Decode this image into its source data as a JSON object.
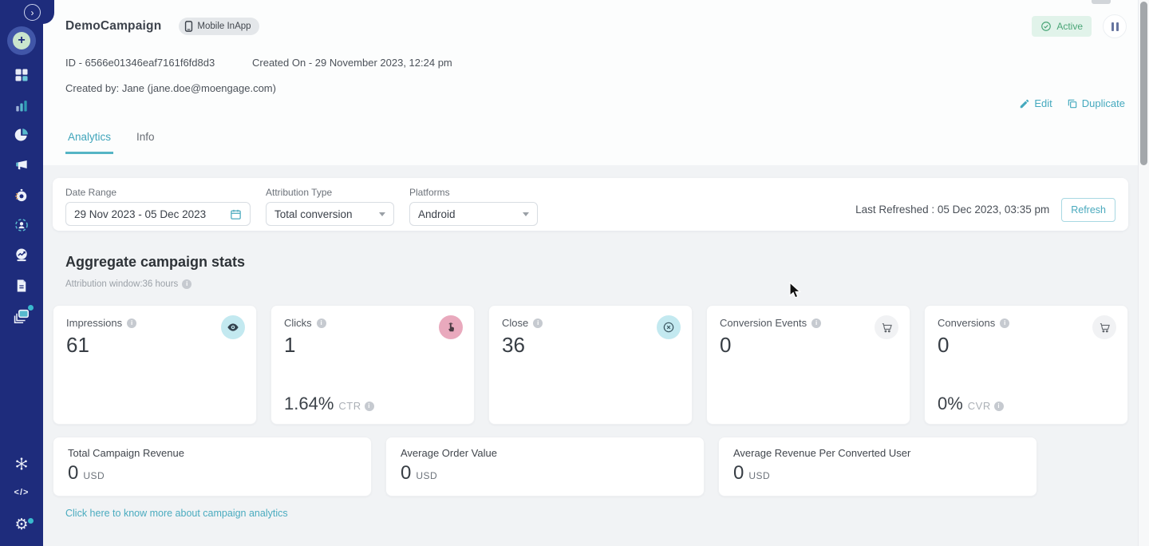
{
  "colors": {
    "navy": "#1e2c7c",
    "teal": "#44a9be",
    "green": "#4aa577",
    "pink_icon_bg": "#e9a9bd",
    "cyan_icon_bg": "#c3e9f0",
    "gray_icon_bg": "#f1f2f4"
  },
  "sidebar": {
    "expand_icon": "chevron-right-icon",
    "items": [
      "plus-create-icon",
      "grid-dashboard-icon",
      "bar-chart-icon",
      "pie-chart-icon",
      "megaphone-icon",
      "stopwatch-icon",
      "user-target-icon",
      "trend-ball-icon",
      "document-icon",
      "layers-icon",
      "asterisk-nodes-icon",
      "code-icon",
      "gear-icon"
    ]
  },
  "header": {
    "title": "DemoCampaign",
    "channel_badge": "Mobile InApp",
    "status_label": "Active",
    "campaign_id": "ID - 6566e01346eaf7161f6fd8d3",
    "created_on": "Created On - 29 November 2023, 12:24 pm",
    "created_by": "Created by: Jane (jane.doe@moengage.com)",
    "edit_label": "Edit",
    "duplicate_label": "Duplicate"
  },
  "tabs": {
    "analytics": "Analytics",
    "info": "Info"
  },
  "filter_bar": {
    "date_range_label": "Date Range",
    "date_range_value": "29 Nov 2023 - 05 Dec 2023",
    "attribution_type_label": "Attribution Type",
    "attribution_type_value": "Total conversion",
    "platforms_label": "Platforms",
    "platforms_value": "Android",
    "last_refreshed": "Last Refreshed : 05 Dec 2023, 03:35 pm",
    "refresh_label": "Refresh"
  },
  "stats": {
    "section_title": "Aggregate campaign stats",
    "attribution_window": "Attribution window:36 hours",
    "cards": [
      {
        "label": "Impressions",
        "value": "61",
        "icon": "eye-icon",
        "icon_bg": "#c3e9f0",
        "sub_value": "",
        "sub_label": ""
      },
      {
        "label": "Clicks",
        "value": "1",
        "icon": "tap-icon",
        "icon_bg": "#e9a9bd",
        "sub_value": "1.64%",
        "sub_label": "CTR"
      },
      {
        "label": "Close",
        "value": "36",
        "icon": "close-circle-icon",
        "icon_bg": "#c3e9f0",
        "sub_value": "",
        "sub_label": ""
      },
      {
        "label": "Conversion Events",
        "value": "0",
        "icon": "cart-icon",
        "icon_bg": "#f1f2f4",
        "sub_value": "",
        "sub_label": ""
      },
      {
        "label": "Conversions",
        "value": "0",
        "icon": "cart-icon",
        "icon_bg": "#f1f2f4",
        "sub_value": "0%",
        "sub_label": "CVR"
      }
    ],
    "revenue_cards": [
      {
        "label": "Total Campaign Revenue",
        "value": "0",
        "currency": "USD"
      },
      {
        "label": "Average Order Value",
        "value": "0",
        "currency": "USD"
      },
      {
        "label": "Average Revenue Per Converted User",
        "value": "0",
        "currency": "USD"
      }
    ],
    "footer_link": "Click here to know more about campaign analytics"
  }
}
